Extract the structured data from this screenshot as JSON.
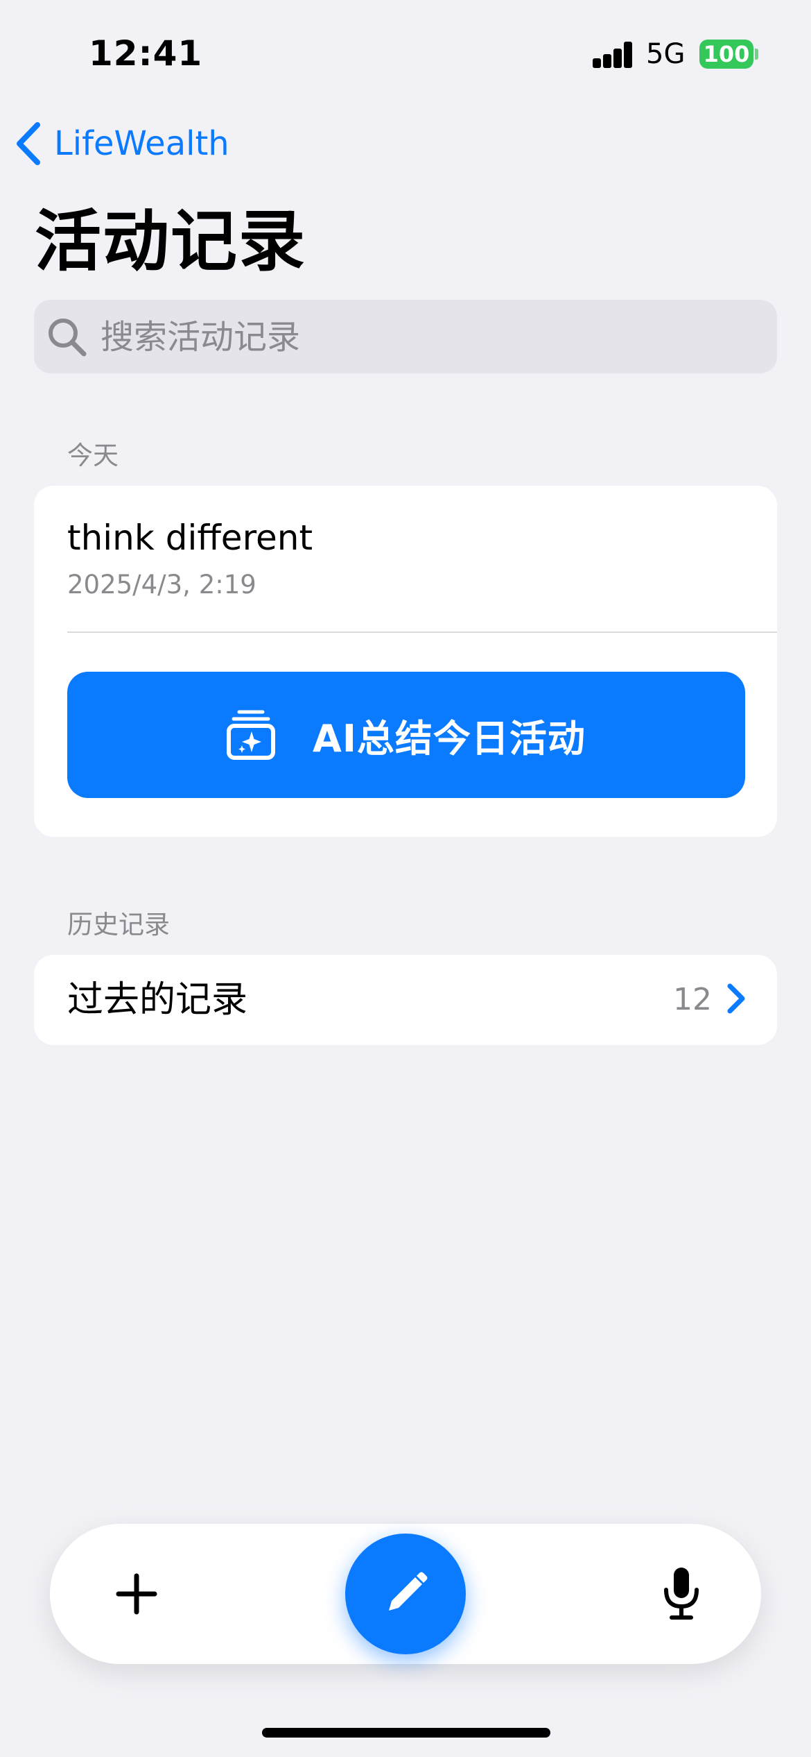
{
  "status_bar": {
    "time": "12:41",
    "network": "5G",
    "battery": "100"
  },
  "nav": {
    "back_label": "LifeWealth"
  },
  "page": {
    "title": "活动记录"
  },
  "search": {
    "placeholder": "搜索活动记录"
  },
  "today": {
    "section_label": "今天",
    "entry": {
      "title": "think different",
      "date": "2025/4/3, 2:19"
    },
    "ai_button_label": "AI总结今日活动"
  },
  "history": {
    "section_label": "历史记录",
    "row_title": "过去的记录",
    "count": "12"
  },
  "colors": {
    "accent": "#0A7AFF",
    "background": "#F1F1F6",
    "battery": "#34C759",
    "secondary_text": "#8A8A8E"
  },
  "icons": {
    "back": "chevron-left-icon",
    "search": "magnifying-glass-icon",
    "ai": "sparkle-stack-icon",
    "chevron": "chevron-right-icon",
    "add": "plus-icon",
    "compose": "pencil-icon",
    "mic": "microphone-icon"
  }
}
